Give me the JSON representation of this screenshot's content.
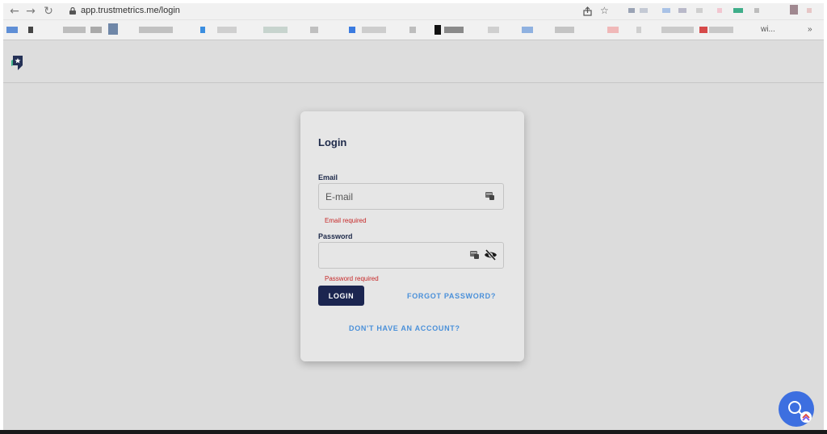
{
  "browser": {
    "url": "app.trustmetrics.me/login",
    "bookmark_overflow_label": "wi...",
    "more_label": "»"
  },
  "login": {
    "title": "Login",
    "email_label": "Email",
    "email_placeholder": "E-mail",
    "email_value": "",
    "email_error": "Email required",
    "password_label": "Password",
    "password_value": "",
    "password_error": "Password required",
    "login_button": "LOGIN",
    "forgot_password": "FORGOT PASSWORD?",
    "signup_link": "DON'T HAVE AN ACCOUNT?"
  },
  "colors": {
    "primary": "#1b2550",
    "link": "#4a90d9",
    "error": "#c62828",
    "help_bubble": "#3d6fe0"
  },
  "icons": {
    "back": "arrow-left",
    "forward": "arrow-right",
    "reload": "reload",
    "share": "share",
    "bookmark": "star",
    "password_visibility": "eye-off",
    "autofill": "key-card"
  }
}
